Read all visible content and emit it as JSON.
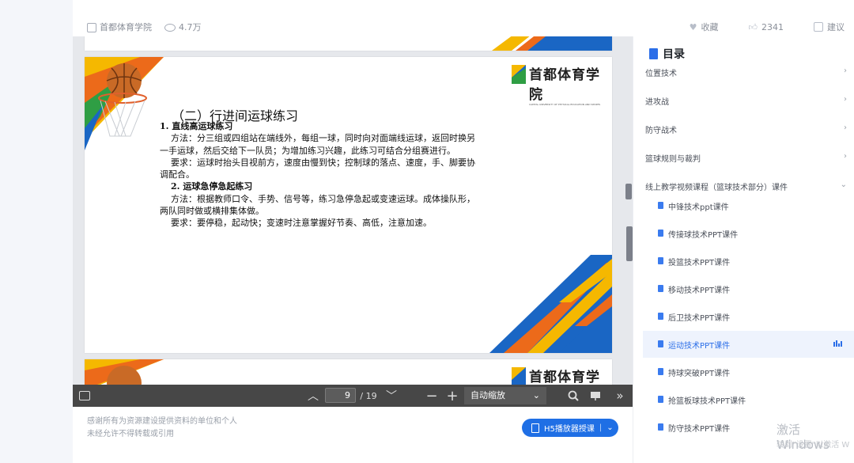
{
  "header": {
    "org": "首都体育学院",
    "views": "4.7万",
    "actions": {
      "favorite": "收藏",
      "likes": "2341",
      "suggest": "建议"
    }
  },
  "slide": {
    "logo_text": "首都体育学院",
    "logo_sub": "CAPITAL UNIVERSITY OF PHYSICAL EDUCATION AND SPORTS",
    "heading": "（二）行进间运球练习",
    "lines": [
      {
        "text": "1. 直线高运球练习",
        "bold": true
      },
      {
        "text": "方法：分三组或四组站在端线外，每组一球，同时向对面端线运球，返回时换另",
        "indent": true
      },
      {
        "text": "一手运球，然后交给下一队员；为增加练习兴趣，此练习可结合分组赛进行。"
      },
      {
        "text": "要求：运球时抬头目视前方，速度由慢到快；控制球的落点、速度，手、脚要协",
        "indent": true
      },
      {
        "text": "调配合。"
      },
      {
        "text": "2. 运球急停急起练习",
        "bold": true,
        "indent": true
      },
      {
        "text": "方法：根据教师口令、手势、信号等，练习急停急起或变速运球。成体操队形，",
        "indent": true
      },
      {
        "text": "两队同时做或横排集体做。"
      },
      {
        "text": "要求：要停稳，起动快；变速时注意掌握好节奏、高低，注意加速。",
        "indent": true
      }
    ]
  },
  "toolbar": {
    "page_current": "9",
    "page_total": "/ 19",
    "zoom": "自动缩放"
  },
  "notice": {
    "line1": "感谢所有为资源建设提供资料的单位和个人",
    "line2": "未经允许不得转载或引用"
  },
  "h5_button": "H5播放器授课",
  "toc": {
    "title": "目录",
    "items": [
      {
        "label": "位置技术"
      },
      {
        "label": "进攻战"
      },
      {
        "label": "防守战术"
      },
      {
        "label": "篮球规则与裁判"
      },
      {
        "label": "线上教学视频课程（篮球技术部分）课件"
      }
    ],
    "sub_items": [
      {
        "label": "中锋技术ppt课件"
      },
      {
        "label": "传接球技术PPT课件"
      },
      {
        "label": "投篮技术PPT课件"
      },
      {
        "label": "移动技术PPT课件"
      },
      {
        "label": "后卫技术PPT课件"
      },
      {
        "label": "运动技术PPT课件"
      },
      {
        "label": "持球突破PPT课件"
      },
      {
        "label": "抢篮板球技术PPT课件"
      },
      {
        "label": "防守技术PPT课件"
      }
    ]
  },
  "watermark": {
    "line1": "激活 Windows",
    "line2": "转到\"设置\"以激活 W"
  }
}
